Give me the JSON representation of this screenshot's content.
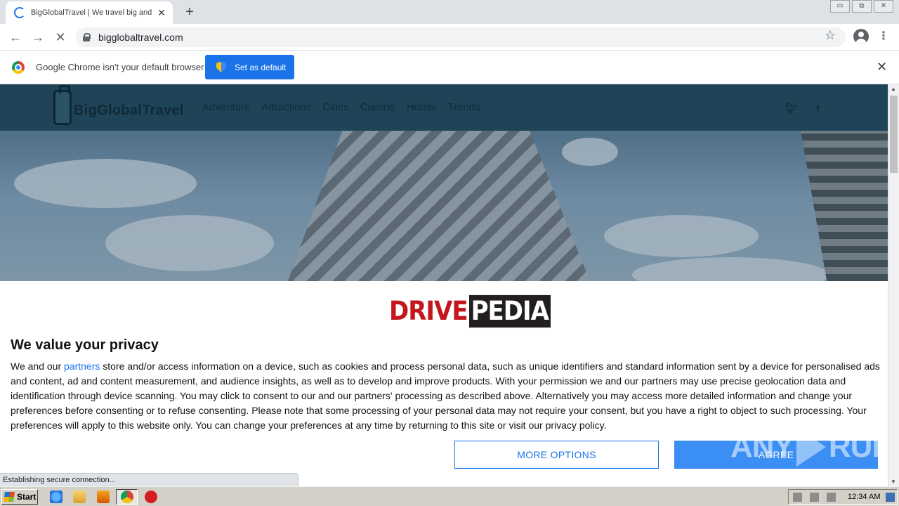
{
  "browser": {
    "tab_title": "BigGlobalTravel | We travel big and g",
    "new_tab_label": "+",
    "url": "bigglobaltravel.com",
    "window_controls": [
      "▭",
      "⧉",
      "✕"
    ]
  },
  "infobar": {
    "message": "Google Chrome isn't your default browser",
    "button_label": "Set as default",
    "close_label": "✕"
  },
  "site": {
    "logo_text": "BigGlobalTravel",
    "nav": [
      "Adventure",
      "Attractions",
      "Cities",
      "Cuisine",
      "Hotels",
      "Trends"
    ],
    "social": [
      "twitter-icon",
      "facebook-icon"
    ]
  },
  "consent": {
    "logo_part1": "DRIVE",
    "logo_part2": "PEDIA",
    "heading": "We value your privacy",
    "body_before_link": "We and our ",
    "link_text": "partners",
    "body_after_link": " store and/or access information on a device, such as cookies and process personal data, such as unique identifiers and standard information sent by a device for personalised ads and content, ad and content measurement, and audience insights, as well as to develop and improve products. With your permission we and our partners may use precise geolocation data and identification through device scanning. You may click to consent to our and our partners' processing as described above. Alternatively you may access more detailed information and change your preferences before consenting or to refuse consenting. Please note that some processing of your personal data may not require your consent, but you have a right to object to such processing. Your preferences will apply to this website only. You can change your preferences at any time by returning to this site or visit our privacy policy.",
    "more_options_label": "MORE OPTIONS",
    "agree_label": "AGREE"
  },
  "status_text": "Establishing secure connection...",
  "watermark": {
    "left": "ANY",
    "right": "RUN"
  },
  "taskbar": {
    "start_label": "Start",
    "clock": "12:34 AM"
  },
  "colors": {
    "accent": "#1a73e8",
    "site_header": "#1f4457",
    "drive_red": "#c4161c",
    "agree_blue": "#3b8ef4"
  }
}
